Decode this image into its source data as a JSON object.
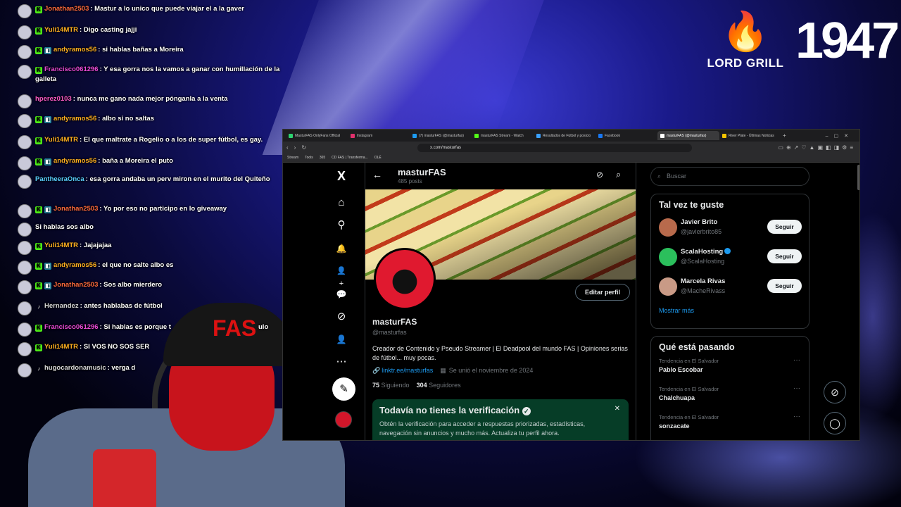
{
  "chat": [
    {
      "user": "Jonathan2503",
      "color": "#ff6a3c",
      "badges": [
        "k"
      ],
      "text": ": Mastur a lo unico que puede viajar el a la gaver"
    },
    {
      "user": "Yuli14MTR",
      "color": "#ffb020",
      "badges": [
        "k"
      ],
      "text": ": Digo casting jajji"
    },
    {
      "user": "andyramos56",
      "color": "#ffb020",
      "badges": [
        "k",
        "g"
      ],
      "text": ": si hablas bañas a Moreira"
    },
    {
      "user": "Francisco061296",
      "color": "#e94ad6",
      "badges": [
        "k"
      ],
      "text": ": Y esa gorra nos la vamos a ganar con humillación de la galleta"
    },
    {
      "user": "hperez0103",
      "color": "#ff5cc8",
      "badges": [],
      "text": ": nunca me gano nada mejor pónganla a la venta"
    },
    {
      "user": "andyramos56",
      "color": "#ffb020",
      "badges": [
        "k",
        "g"
      ],
      "text": ": albo si no saltas"
    },
    {
      "user": "Yuli14MTR",
      "color": "#ffb020",
      "badges": [
        "k"
      ],
      "text": ": El que maltrate a Rogelio o a los de super fútbol, es gay."
    },
    {
      "user": "andyramos56",
      "color": "#ffb020",
      "badges": [
        "k",
        "g"
      ],
      "text": ": baña a Moreira el puto"
    },
    {
      "user": "PantheeraOnca",
      "color": "#5ad0ff",
      "badges": [],
      "text": ": esa gorra andaba un perv miron en el murito del Quiteño"
    },
    {
      "user": "Jonathan2503",
      "color": "#ff6a3c",
      "badges": [
        "k",
        "g"
      ],
      "text": ": Yo por eso no participo en lo giveaway"
    },
    {
      "user": "",
      "color": "#ffffff",
      "badges": [],
      "text": "Si hablas sos albo"
    },
    {
      "user": "Yuli14MTR",
      "color": "#ffb020",
      "badges": [
        "k"
      ],
      "text": ": Jajajajaa"
    },
    {
      "user": "andyramos56",
      "color": "#ffb020",
      "badges": [
        "k",
        "g"
      ],
      "text": ": el que no salte albo es"
    },
    {
      "user": "Jonathan2503",
      "color": "#ff6a3c",
      "badges": [
        "k",
        "g"
      ],
      "text": ": Sos albo mierdero"
    },
    {
      "user": "Hernandez",
      "color": "#d6d6d6",
      "badges": [
        "t"
      ],
      "text": ": antes hablabas de fútbol"
    },
    {
      "user": "Francisco061296",
      "color": "#e94ad6",
      "badges": [
        "k"
      ],
      "text": ": Si hablas es porque t"
    },
    {
      "user": "Yuli14MTR",
      "color": "#ffb020",
      "badges": [
        "k"
      ],
      "text": ": SI VOS NO SOS SER"
    },
    {
      "user": "hugocardonamusic",
      "color": "#d6d6d6",
      "badges": [
        "t"
      ],
      "text": ": verga d"
    }
  ],
  "chat_trailing": {
    "msg15": "ulo"
  },
  "brand": {
    "lord_grill": "LORD GRILL",
    "year": "1947",
    "flame_color": "#e8731d"
  },
  "browser": {
    "tabs": [
      {
        "label": "MasturFAS OnlyFans Official",
        "color": "#2dd36f"
      },
      {
        "label": "Instagram",
        "color": "#e1306c"
      },
      {
        "label": "(7) masturFAS (@masturfas)",
        "color": "#1d9bf0"
      },
      {
        "label": "masturFAS Stream - Watch",
        "color": "#53fc18"
      },
      {
        "label": "Resultados de Fútbol y posicio",
        "color": "#3aa0ff"
      },
      {
        "label": "Facebook",
        "color": "#1877f2"
      },
      {
        "label": "masturFAS (@masturfas)",
        "color": "#ffffff",
        "active": true
      },
      {
        "label": "River Plate - Últimas Noticias",
        "color": "#f5c400"
      }
    ],
    "url": "x.com/masturfas",
    "bookmarks": [
      "Stream",
      "Tools",
      "365",
      "CD FAS | Transferma...",
      "OLÉ"
    ]
  },
  "profile": {
    "display_name": "masturFAS",
    "posts": "485 posts",
    "name": "masturFAS",
    "handle": "@masturfas",
    "edit_label": "Editar perfil",
    "bio": "Creador de Contenido y Pseudo Streamer | El Deadpool del mundo FAS | Opiniones serias de fútbol... muy pocas.",
    "link": "linktr.ee/masturfas",
    "joined": "Se unió el noviembre de 2024",
    "following_count": "75",
    "following_label": "Siguiendo",
    "followers_count": "304",
    "followers_label": "Seguidores",
    "verify_title": "Todavía no tienes la verificación",
    "verify_text": "Obtén la verificación para acceder a respuestas priorizadas, estadísticas, navegación sin anuncios y mucho más. Actualiza tu perfil ahora."
  },
  "sidebar": {
    "search_placeholder": "Buscar",
    "suggest_title": "Tal vez te guste",
    "suggestions": [
      {
        "name": "Javier Brito",
        "handle": "@javierbrito85",
        "btn": "Seguir",
        "avatar": "#b86a4c"
      },
      {
        "name": "ScalaHosting",
        "handle": "@ScalaHosting",
        "btn": "Seguir",
        "avatar": "#2bbf5c"
      },
      {
        "name": "Marcela Rivas",
        "handle": "@MacheRivass",
        "btn": "Seguir",
        "avatar": "#c99a86"
      }
    ],
    "show_more": "Mostrar más",
    "trends_title": "Qué está pasando",
    "trends": [
      {
        "context": "Tendencia en El Salvador",
        "name": "Pablo Escobar"
      },
      {
        "context": "Tendencia en El Salvador",
        "name": "Chalchuapa"
      },
      {
        "context": "Tendencia en El Salvador",
        "name": "sonzacate"
      }
    ]
  },
  "icons": {
    "x_logo": "X",
    "home": "⌂",
    "search": "⚲",
    "bell": "🔔",
    "people": "👤+",
    "chat": "💬",
    "grok": "⊘",
    "profile": "👤",
    "more": "⋯",
    "post": "✎",
    "back": "←",
    "search_small": "⌕"
  }
}
